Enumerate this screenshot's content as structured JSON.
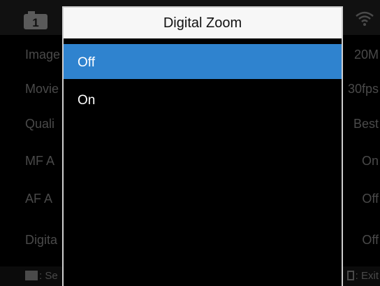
{
  "background_menu": {
    "tab_number": "1",
    "wifi_icon": "wifi-icon",
    "rows": [
      {
        "label": "Image",
        "value": "20M"
      },
      {
        "label": "Movie",
        "value": "30fps"
      },
      {
        "label": "Quali",
        "value": "Best"
      },
      {
        "label": "MF A",
        "value": "On"
      },
      {
        "label": "AF A",
        "value": "Off"
      },
      {
        "label": "Digita",
        "value": "Off"
      }
    ],
    "hint_left": ": Se",
    "hint_right": ": Exit"
  },
  "dialog": {
    "title": "Digital Zoom",
    "options": [
      {
        "label": "Off",
        "selected": true
      },
      {
        "label": "On",
        "selected": false
      }
    ]
  },
  "colors": {
    "selection": "#2f83cf",
    "title_bar": "#f7f7f7",
    "dialog_border": "#cfcfcf"
  }
}
